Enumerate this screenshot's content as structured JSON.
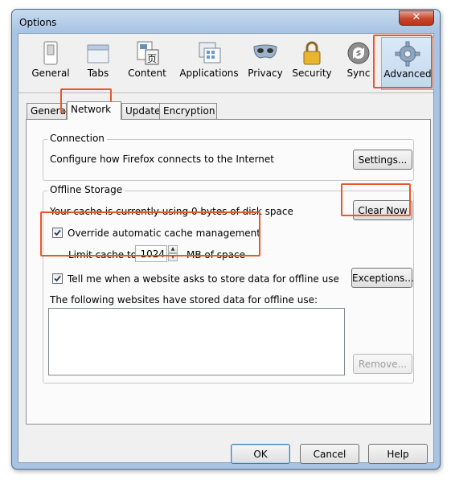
{
  "window": {
    "title": "Options",
    "close_glyph": "✕"
  },
  "panes": [
    {
      "label": "General",
      "icon": "general-switch-icon"
    },
    {
      "label": "Tabs",
      "icon": "tabs-window-icon"
    },
    {
      "label": "Content",
      "icon": "content-page-icon"
    },
    {
      "label": "Applications",
      "icon": "applications-icon"
    },
    {
      "label": "Privacy",
      "icon": "privacy-mask-icon"
    },
    {
      "label": "Security",
      "icon": "padlock-icon"
    },
    {
      "label": "Sync",
      "icon": "sync-arrows-icon"
    },
    {
      "label": "Advanced",
      "icon": "gear-icon",
      "selected": true
    }
  ],
  "subtabs": [
    {
      "label": "Genera"
    },
    {
      "label": "Network",
      "active": true
    },
    {
      "label": "Update"
    },
    {
      "label": "Encryption"
    }
  ],
  "connection": {
    "caption": "Connection",
    "description": "Configure how Firefox connects to the Internet",
    "settings_label": "Settings..."
  },
  "offline": {
    "caption": "Offline Storage",
    "cache_usage": "Your cache is currently using 0 bytes of disk space",
    "clear_now_label": "Clear Now",
    "override_label": "Override automatic cache management",
    "override_checked": true,
    "limit_prefix": "Limit cache to",
    "limit_value": "1024",
    "limit_suffix": "MB of space",
    "tell_me_label": "Tell me when a website asks to store data for offline use",
    "tell_me_checked": true,
    "exceptions_label": "Exceptions...",
    "stored_label": "The following websites have stored data for offline use:",
    "remove_label": "Remove..."
  },
  "footer": {
    "ok_label": "OK",
    "cancel_label": "Cancel",
    "help_label": "Help"
  },
  "highlight_color": "#e8582b"
}
